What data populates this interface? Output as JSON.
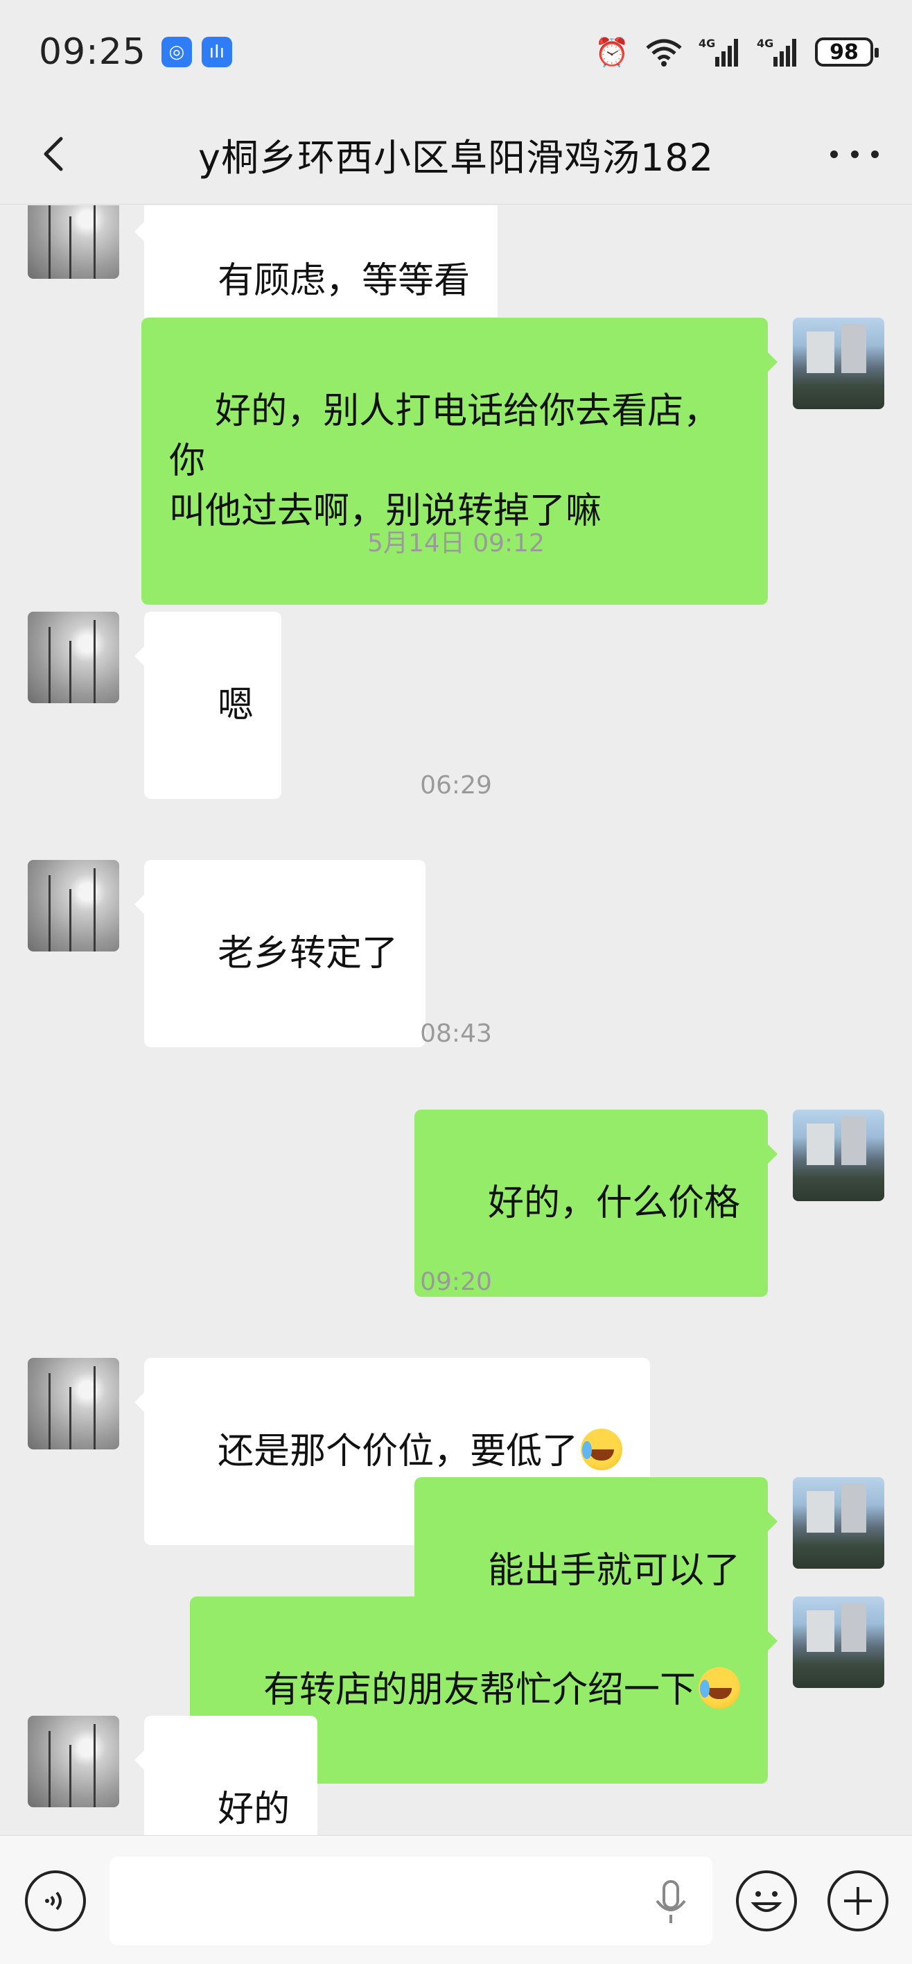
{
  "status_bar": {
    "time": "09:25",
    "battery": "98",
    "icons": [
      "browser-icon",
      "voice-app-icon",
      "alarm-icon",
      "wifi-icon",
      "signal-4g-icon",
      "signal-4g-icon",
      "battery-icon"
    ]
  },
  "header": {
    "title": "y桐乡环西小区阜阳滑鸡汤182"
  },
  "messages": [
    {
      "from": "other",
      "text": "有顾虑，等等看"
    },
    {
      "from": "me",
      "text": "好的，别人打电话给你去看店，你\n叫他过去啊，别说转掉了嘛"
    },
    {
      "type": "time",
      "text": "5月14日 09:12"
    },
    {
      "from": "other",
      "text": "嗯"
    },
    {
      "type": "time",
      "text": "06:29"
    },
    {
      "from": "other",
      "text": "老乡转定了"
    },
    {
      "type": "time",
      "text": "08:43"
    },
    {
      "from": "me",
      "text": "好的，什么价格"
    },
    {
      "type": "time",
      "text": "09:20"
    },
    {
      "from": "other",
      "text": "还是那个价位，要低了",
      "emoji": "face-with-tears-of-joy"
    },
    {
      "from": "me",
      "text": "能出手就可以了"
    },
    {
      "from": "me",
      "text": "有转店的朋友帮忙介绍一下",
      "emoji": "rolling-on-floor-laughing"
    },
    {
      "from": "other",
      "text": "好的"
    }
  ],
  "input_bar": {
    "value": "",
    "icons": [
      "voice-toggle-icon",
      "microphone-icon",
      "emoji-icon",
      "plus-icon"
    ]
  }
}
